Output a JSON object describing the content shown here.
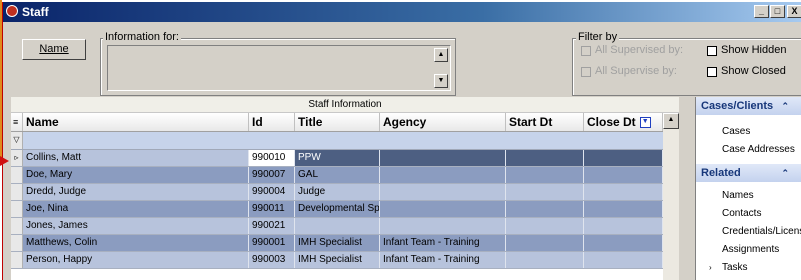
{
  "window": {
    "title": "Staff",
    "min_glyph": "_",
    "max_glyph": "□",
    "close_glyph": "X"
  },
  "name_button": {
    "label": "Name"
  },
  "info_group": {
    "label": "Information for:",
    "value": ""
  },
  "filter_group": {
    "label": "Filter by",
    "all_supervised_by": {
      "label": "All Supervised by:",
      "checked": false,
      "enabled": false
    },
    "all_supervise_by": {
      "label": "All Supervise by:",
      "checked": false,
      "enabled": false
    },
    "show_hidden": {
      "label": "Show Hidden",
      "checked": false
    },
    "show_closed": {
      "label": "Show Closed",
      "checked": false
    }
  },
  "grid": {
    "caption": "Staff Information",
    "columns": [
      "Name",
      "Id",
      "Title",
      "Agency",
      "Start Dt",
      "Close Dt"
    ],
    "rows": [
      {
        "name": "Collins, Matt",
        "id": "990010",
        "title": "PPW",
        "agency": "",
        "start": "",
        "close": "",
        "selected": true
      },
      {
        "name": "Doe, Mary",
        "id": "990007",
        "title": "GAL",
        "agency": "",
        "start": "",
        "close": ""
      },
      {
        "name": "Dredd, Judge",
        "id": "990004",
        "title": "Judge",
        "agency": "",
        "start": "",
        "close": ""
      },
      {
        "name": "Joe, Nina",
        "id": "990011",
        "title": "Developmental Spe",
        "agency": "",
        "start": "",
        "close": ""
      },
      {
        "name": "Jones, James",
        "id": "990021",
        "title": "",
        "agency": "",
        "start": "",
        "close": ""
      },
      {
        "name": "Matthews, Colin",
        "id": "990001",
        "title": "IMH Specialist",
        "agency": "Infant Team - Training",
        "start": "",
        "close": ""
      },
      {
        "name": "Person, Happy",
        "id": "990003",
        "title": "IMH Specialist",
        "agency": "Infant Team - Training",
        "start": "",
        "close": ""
      }
    ]
  },
  "right_pane": {
    "sections": [
      {
        "title": "Cases/Clients",
        "items": [
          "Cases",
          "Case Addresses"
        ]
      },
      {
        "title": "Related",
        "items": [
          "Names",
          "Contacts",
          "Credentials/Licenses",
          "Assignments",
          "Tasks"
        ]
      }
    ]
  },
  "colors": {
    "title_gradient_start": "#0a246a",
    "row_selected": "#4d5f82",
    "row_dark": "#8b9cc0",
    "row_light": "#b7c3dc",
    "filter_row": "#c6d3ea",
    "pane_header_text": "#17377a"
  }
}
